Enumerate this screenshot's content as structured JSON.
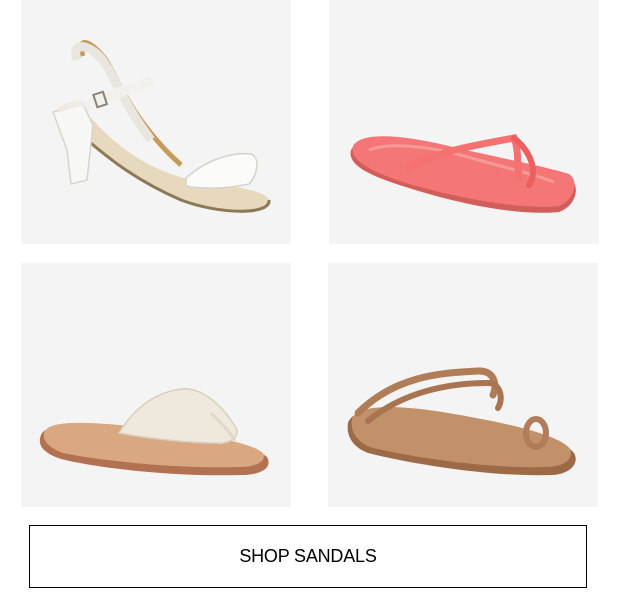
{
  "products": [
    {
      "name": "white-block-heel-sandal",
      "color": "#ffffff"
    },
    {
      "name": "coral-flip-flop",
      "color": "#f47676"
    },
    {
      "name": "cream-slide-sandal",
      "color": "#efe8dc"
    },
    {
      "name": "tan-strappy-toe-ring-sandal",
      "color": "#c1916a"
    }
  ],
  "cta": {
    "label": "SHOP SANDALS"
  }
}
